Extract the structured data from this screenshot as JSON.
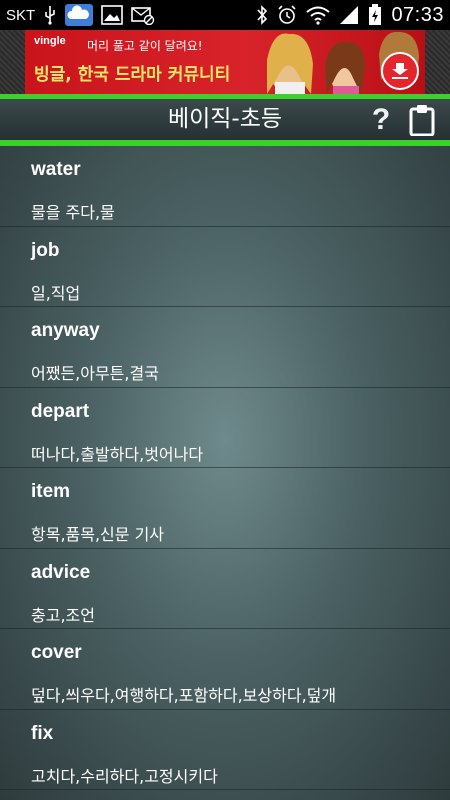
{
  "status_bar": {
    "carrier": "SKT",
    "time": "07:33"
  },
  "ad": {
    "brand": "vingle",
    "line1": "머리 풀고 같이 달려요!",
    "line2": "빙글, 한국 드라마 커뮤니티"
  },
  "header": {
    "title": "베이직-초등",
    "help_label": "?"
  },
  "words": [
    {
      "word": "water",
      "meaning": "물을 주다,물"
    },
    {
      "word": "job",
      "meaning": "일,직업"
    },
    {
      "word": "anyway",
      "meaning": "어쨌든,아무튼,결국"
    },
    {
      "word": "depart",
      "meaning": "떠나다,출발하다,벗어나다"
    },
    {
      "word": "item",
      "meaning": "항목,품목,신문 기사"
    },
    {
      "word": "advice",
      "meaning": "충고,조언"
    },
    {
      "word": "cover",
      "meaning": "덮다,씌우다,여행하다,포함하다,보상하다,덮개"
    },
    {
      "word": "fix",
      "meaning": "고치다,수리하다,고정시키다"
    }
  ],
  "colors": {
    "accent_green": "#39d12a",
    "ad_red": "#d8232a"
  }
}
